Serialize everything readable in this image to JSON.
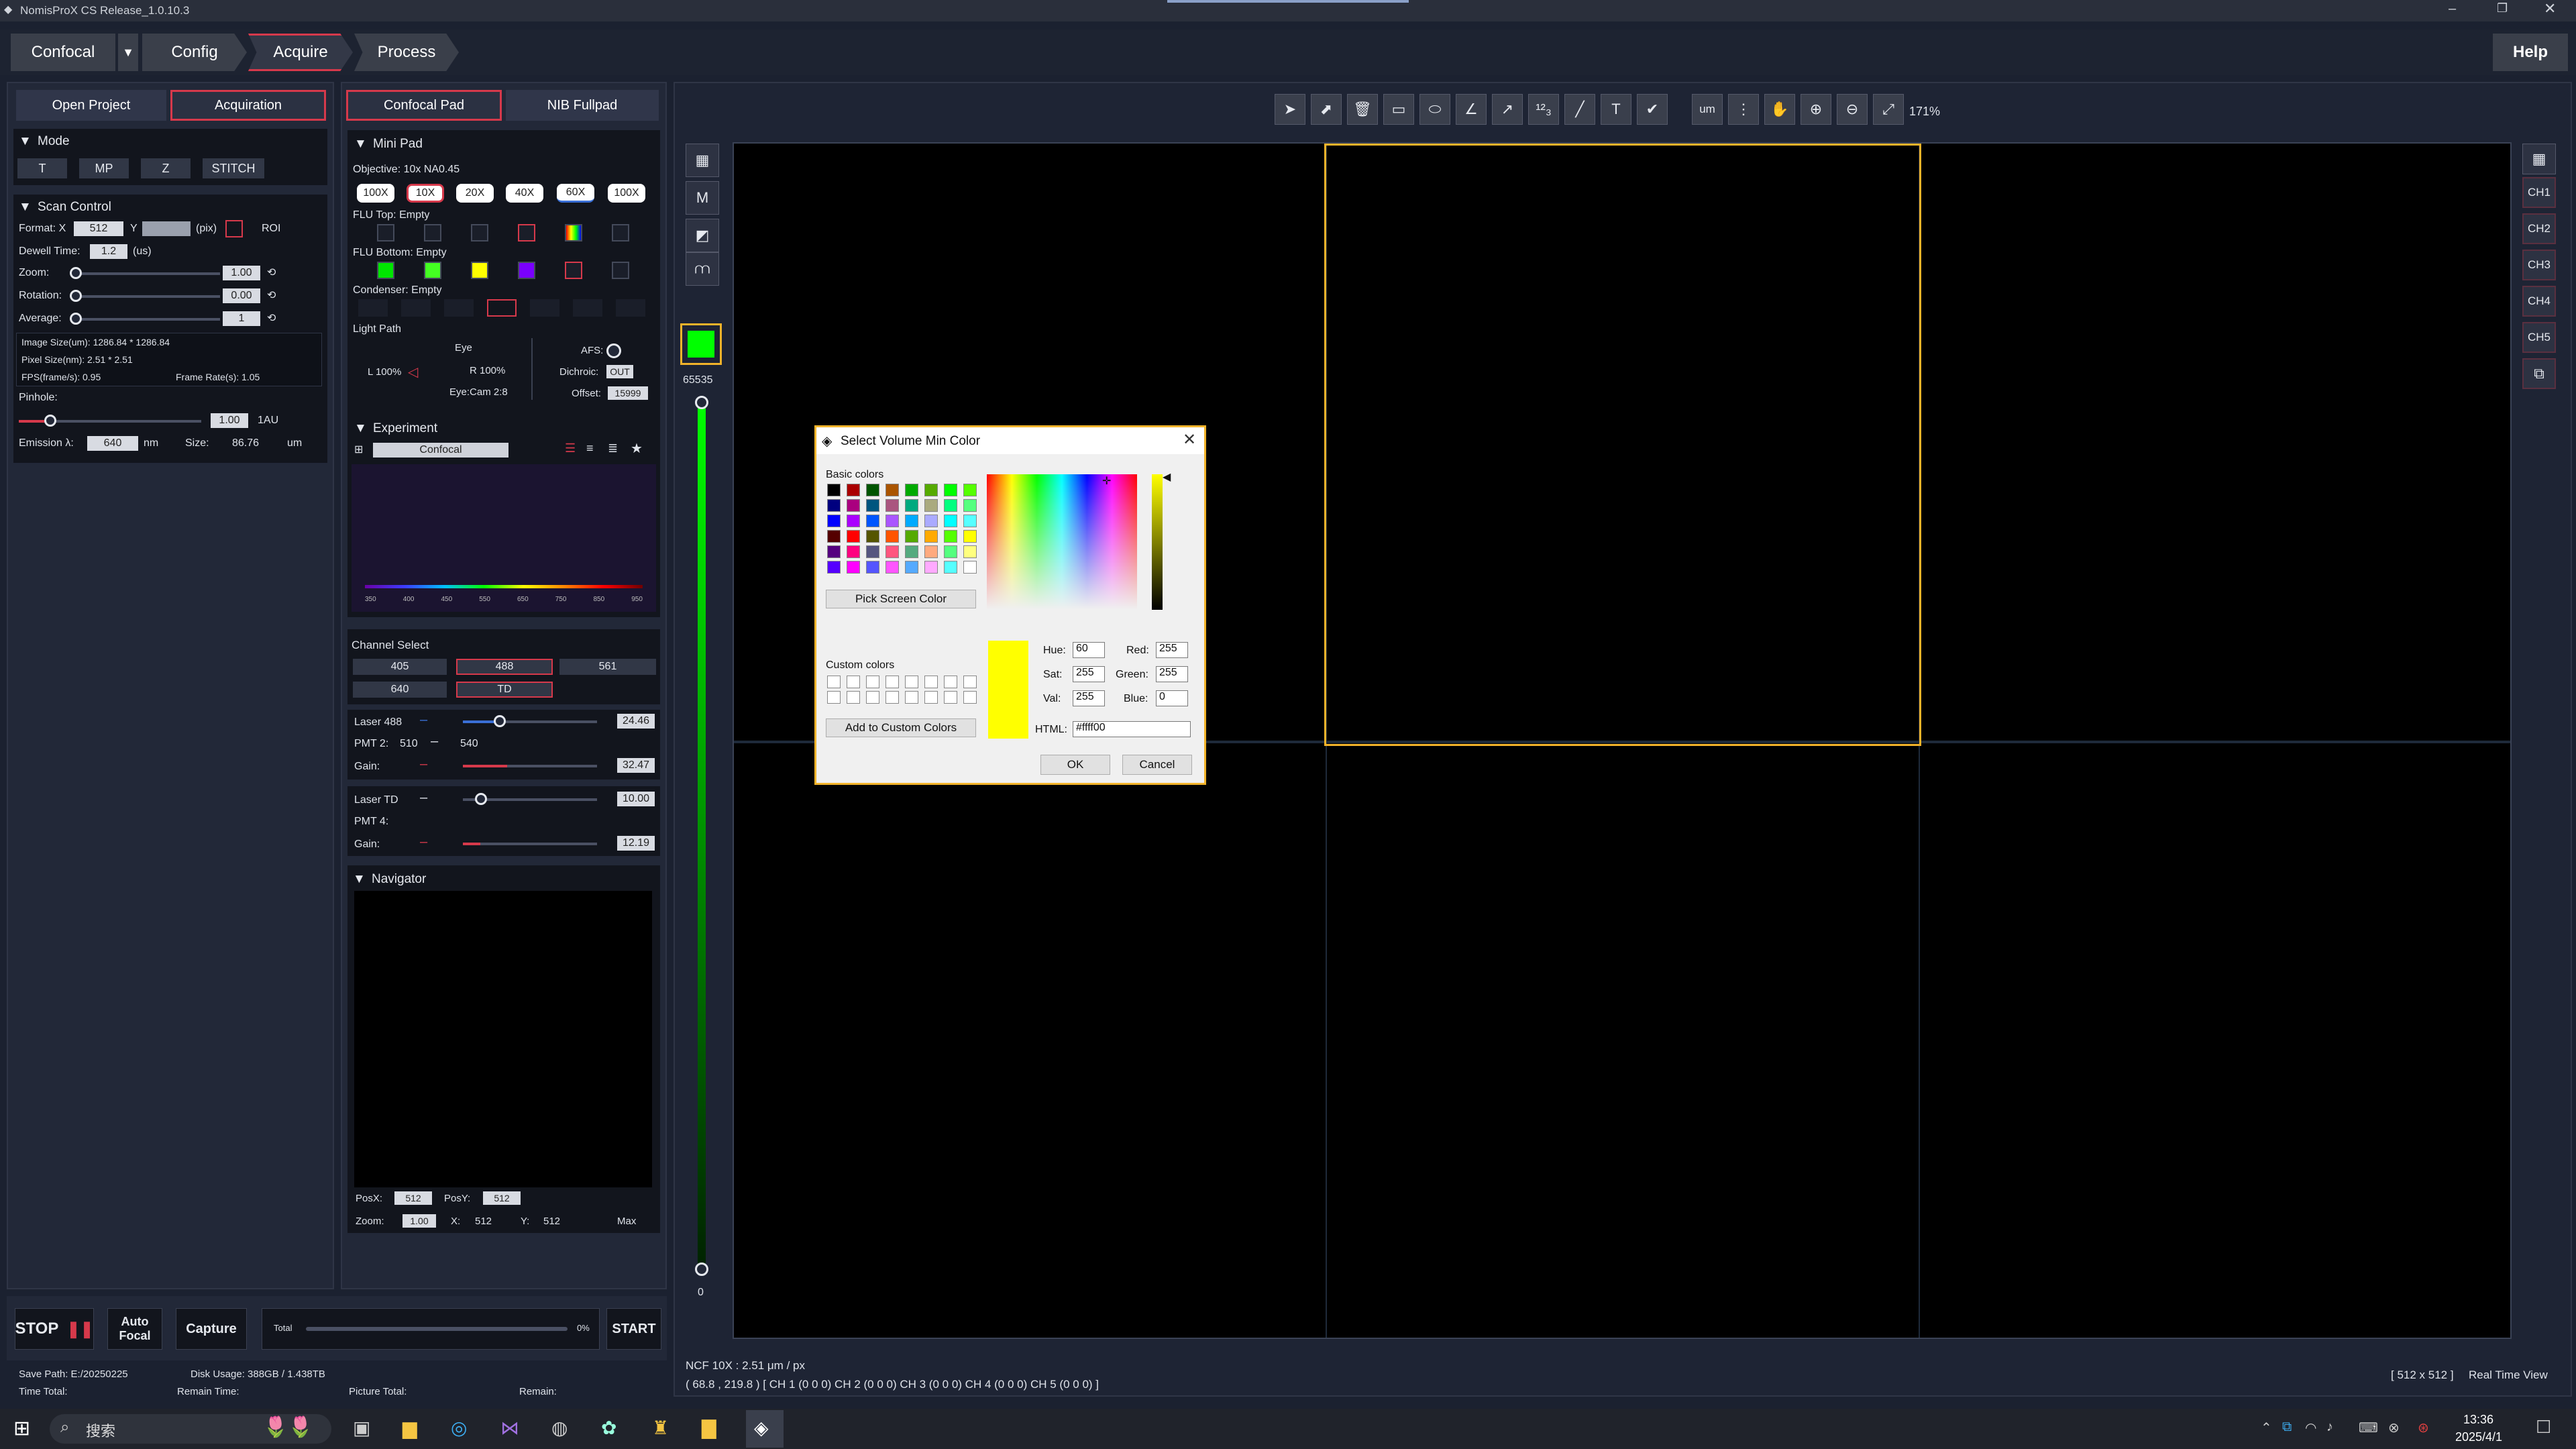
{
  "window": {
    "title": "NomisProX CS Release_1.0.10.3"
  },
  "nav": {
    "mode_label": "Confocal",
    "dropdown_icon": "caret-down-icon",
    "tabs": [
      "Config",
      "Acquire",
      "Process"
    ],
    "help": "Help"
  },
  "left": {
    "tabs": [
      "Open Project",
      "Acquiration"
    ],
    "mode": {
      "title": "Mode",
      "buttons": [
        "T",
        "MP",
        "Z",
        "STITCH"
      ]
    },
    "scan": {
      "title": "Scan Control",
      "format_label": "Format: X",
      "format_x": "512",
      "y_label": "Y",
      "pix_label": "(pix)",
      "roi": "ROI",
      "dwell_label": "Dewell Time:",
      "dwell_value": "1.2",
      "dwell_unit": "(us)",
      "zoom_label": "Zoom:",
      "zoom_value": "1.00",
      "rotation_label": "Rotation:",
      "rotation_value": "0.00",
      "average_label": "Average:",
      "average_value": "1",
      "image_size": "Image Size(um):  1286.84 * 1286.84",
      "pixel_size": "Pixel Size(nm):   2.51 * 2.51",
      "fps": "FPS(frame/s):       0.95",
      "frame_rate": "Frame Rate(s):  1.05",
      "pinhole_label": "Pinhole:",
      "pinhole_value": "1.00",
      "pinhole_unit": "1AU",
      "emission_label": "Emission λ:",
      "emission_value": "640",
      "emission_unit": "nm",
      "size_label": "Size:",
      "size_value": "86.76",
      "size_unit": "um"
    },
    "bottom": {
      "stop": "STOP",
      "auto_focal": "Auto\nFocal",
      "capture": "Capture",
      "total_label": "Total",
      "progress_text": "0%",
      "progress": 0,
      "start": "START"
    }
  },
  "mid": {
    "tabs": [
      "Confocal Pad",
      "NIB Fullpad"
    ],
    "minipad": {
      "title": "Mini Pad",
      "objective": "Objective: 10x NA0.45",
      "objectives": [
        "100X",
        "10X",
        "20X",
        "40X",
        "60X",
        "100X"
      ],
      "flu_top": "FLU Top: Empty",
      "flu_bottom": "FLU Bottom: Empty",
      "condenser": "Condenser: Empty",
      "light_path": "Light Path",
      "eye": "Eye",
      "l100": "L 100%",
      "r100": "R 100%",
      "eyecam": "Eye:Cam 2:8",
      "afs": "AFS:",
      "dichroic": "Dichroic:",
      "dichroic_value": "OUT",
      "offset_label": "Offset:",
      "offset_value": "15999"
    },
    "experiment": {
      "title": "Experiment",
      "select": "Confocal",
      "spectrum_ticks": [
        "350",
        "400",
        "450",
        "550",
        "650",
        "750",
        "850",
        "950"
      ]
    },
    "channel": {
      "title": "Channel Select",
      "items": [
        "405",
        "488",
        "561",
        "640",
        "TD"
      ]
    },
    "laser488": {
      "label": "Laser 488",
      "value": "24.46",
      "pmt_label": "PMT 2:",
      "pmt_from": "510",
      "pmt_to": "540",
      "gain_label": "Gain:",
      "gain_value": "32.47"
    },
    "laserTD": {
      "label": "Laser TD",
      "value": "10.00",
      "pmt_label": "PMT 4:",
      "gain_label": "Gain:",
      "gain_value": "12.19"
    },
    "navigator": {
      "title": "Navigator",
      "posx_label": "PosX:",
      "posx": "512",
      "posy_label": "PosY:",
      "posy": "512",
      "zoom_label": "Zoom:",
      "zoom": "1.00",
      "x_label": "X:",
      "x": "512",
      "y_label": "Y:",
      "y": "512",
      "max": "Max"
    }
  },
  "viewer": {
    "zoom_level": "171%",
    "unit_tool": "um",
    "lut_max": "65535",
    "lut_min": "0",
    "channels": [
      "CH1",
      "CH2",
      "CH3",
      "CH4",
      "CH5"
    ],
    "status_ncf": "NCF 10X : 2.51 μm / px",
    "status_coords": "( 68.8 , 219.8 ) [ CH 1  (0 0 0) CH 2  (0 0 0) CH 3  (0 0 0) CH 4  (0 0 0) CH 5  (0 0 0) ]",
    "status_res": "[ 512 x 512 ]",
    "status_mode": "Real Time View"
  },
  "dialog": {
    "title": "Select Volume Min Color",
    "basic_colors": "Basic colors",
    "pick_screen": "Pick Screen Color",
    "custom_colors": "Custom colors",
    "add_custom": "Add to Custom Colors",
    "hue_label": "Hue:",
    "hue": "60",
    "sat_label": "Sat:",
    "sat": "255",
    "val_label": "Val:",
    "val": "255",
    "red_label": "Red:",
    "red": "255",
    "green_label": "Green:",
    "green": "255",
    "blue_label": "Blue:",
    "blue": "0",
    "html_label": "HTML:",
    "html": "#ffff00",
    "ok": "OK",
    "cancel": "Cancel",
    "current_color": "#ffff00"
  },
  "footer": {
    "save_path": "Save Path:   E:/20250225",
    "disk_usage": "Disk Usage:   388GB / 1.438TB",
    "time_total": "Time Total:",
    "remain_time": "Remain Time:",
    "picture_total": "Picture Total:",
    "remain": "Remain:"
  },
  "taskbar": {
    "search": "搜索",
    "time": "13:36",
    "date": "2025/4/1"
  },
  "colors": {
    "accent_red": "#d6394b",
    "frame_orange": "#f2b32a",
    "lut_green": "#00ff00"
  }
}
